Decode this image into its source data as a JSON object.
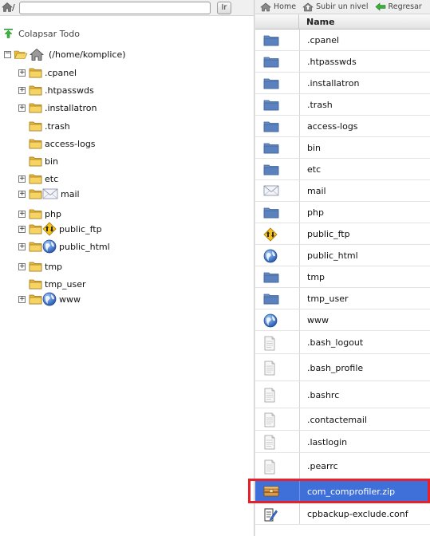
{
  "pathbar": {
    "path_prefix": "/",
    "path_value": "",
    "go_label": "Ir"
  },
  "tree": {
    "collapse_label": "Colapsar Todo",
    "root_label": "(/home/komplice)",
    "items": [
      {
        "label": ".cpanel",
        "expandable": true,
        "icon": "folder-icon"
      },
      {
        "label": ".htpasswds",
        "expandable": true,
        "icon": "folder-icon"
      },
      {
        "label": ".installatron",
        "expandable": true,
        "icon": "folder-icon"
      },
      {
        "label": ".trash",
        "expandable": false,
        "icon": "folder-icon"
      },
      {
        "label": "access-logs",
        "expandable": false,
        "icon": "folder-icon"
      },
      {
        "label": "bin",
        "expandable": false,
        "icon": "folder-icon"
      },
      {
        "label": "etc",
        "expandable": true,
        "icon": "folder-icon"
      },
      {
        "label": "mail",
        "expandable": true,
        "icon": "mail-icon"
      },
      {
        "label": "php",
        "expandable": true,
        "icon": "folder-icon"
      },
      {
        "label": "public_ftp",
        "expandable": true,
        "icon": "ftp-icon"
      },
      {
        "label": "public_html",
        "expandable": true,
        "icon": "globe-icon"
      },
      {
        "label": "tmp",
        "expandable": true,
        "icon": "folder-icon"
      },
      {
        "label": "tmp_user",
        "expandable": false,
        "icon": "folder-icon"
      },
      {
        "label": "www",
        "expandable": true,
        "icon": "globe-icon"
      }
    ]
  },
  "toolbar": {
    "home_label": "Home",
    "up_label": "Subir un nivel",
    "back_label": "Regresar"
  },
  "table": {
    "name_header": "Name",
    "rows": [
      {
        "name": ".cpanel",
        "icon": "folder-icon"
      },
      {
        "name": ".htpasswds",
        "icon": "folder-icon"
      },
      {
        "name": ".installatron",
        "icon": "folder-icon"
      },
      {
        "name": ".trash",
        "icon": "folder-icon"
      },
      {
        "name": "access-logs",
        "icon": "folder-icon"
      },
      {
        "name": "bin",
        "icon": "folder-icon"
      },
      {
        "name": "etc",
        "icon": "folder-icon"
      },
      {
        "name": "mail",
        "icon": "mail-icon"
      },
      {
        "name": "php",
        "icon": "folder-icon"
      },
      {
        "name": "public_ftp",
        "icon": "ftp-icon"
      },
      {
        "name": "public_html",
        "icon": "globe-icon"
      },
      {
        "name": "tmp",
        "icon": "folder-icon"
      },
      {
        "name": "tmp_user",
        "icon": "folder-icon"
      },
      {
        "name": "www",
        "icon": "globe-icon"
      },
      {
        "name": ".bash_logout",
        "icon": "file-icon"
      },
      {
        "name": ".bash_profile",
        "icon": "file-icon"
      },
      {
        "name": ".bashrc",
        "icon": "file-icon"
      },
      {
        "name": ".contactemail",
        "icon": "file-icon"
      },
      {
        "name": ".lastlogin",
        "icon": "file-icon"
      },
      {
        "name": ".pearrc",
        "icon": "file-icon"
      },
      {
        "name": "com_comprofiler.zip",
        "icon": "archive-icon",
        "selected": true
      },
      {
        "name": "cpbackup-exclude.conf",
        "icon": "text-file-icon"
      }
    ]
  },
  "colors": {
    "selection": "#3f6fd9",
    "highlight_border": "#e8202a",
    "folder": "#f2c74a",
    "blue_folder": "#4a7fc4"
  }
}
